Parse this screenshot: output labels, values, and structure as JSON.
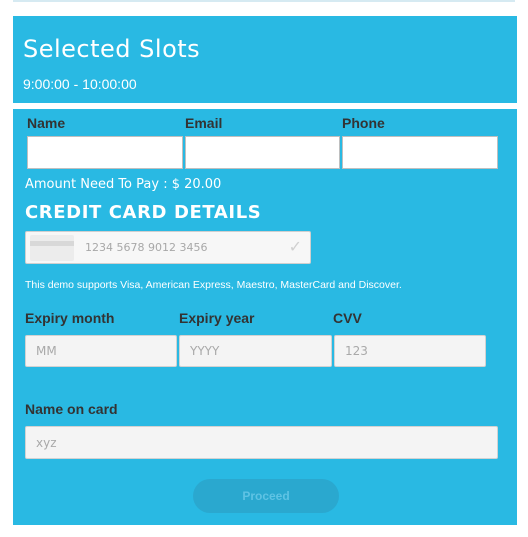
{
  "header": {
    "title": "Selected Slots",
    "time_range": "9:00:00 - 10:00:00"
  },
  "contact": {
    "name_label": "Name",
    "email_label": "Email",
    "phone_label": "Phone"
  },
  "payment": {
    "amount_text": "Amount Need To Pay : $ 20.00",
    "section_title": "CREDIT CARD DETAILS",
    "card_number_placeholder": "1234 5678 9012 3456",
    "support_text": "This demo supports Visa, American Express, Maestro, MasterCard and Discover.",
    "expiry_month_label": "Expiry month",
    "expiry_month_placeholder": "MM",
    "expiry_year_label": "Expiry year",
    "expiry_year_placeholder": "YYYY",
    "cvv_label": "CVV",
    "cvv_placeholder": "123",
    "name_on_card_label": "Name on card",
    "name_on_card_placeholder": "xyz",
    "proceed_label": "Proceed"
  },
  "icons": {
    "card": "credit-card-icon",
    "check": "checkmark-icon"
  },
  "colors": {
    "panel": "#29b9e3",
    "button": "#2aa8cf",
    "text": "#333333"
  }
}
